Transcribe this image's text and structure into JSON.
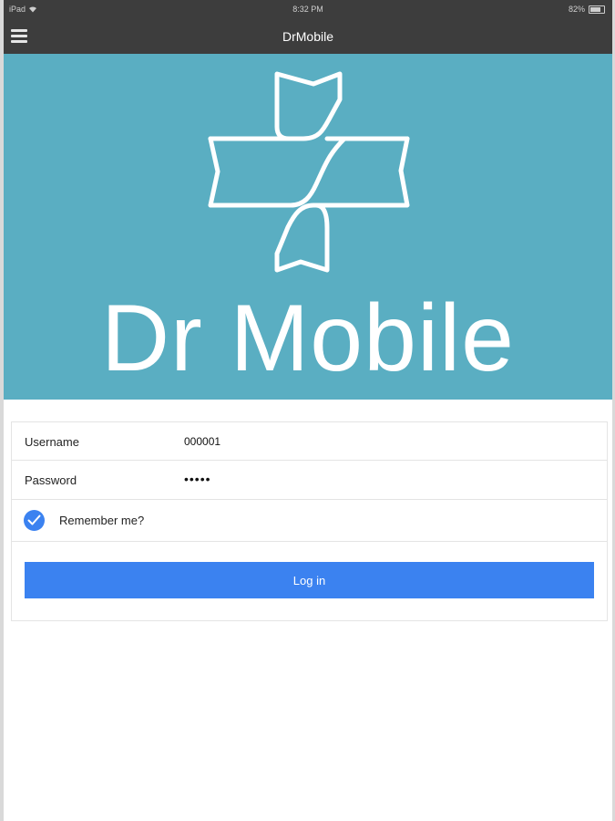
{
  "status_bar": {
    "device": "iPad",
    "wifi_icon": "wifi-icon",
    "time": "8:32 PM",
    "battery_percent": "82%",
    "battery_icon": "battery-icon"
  },
  "nav": {
    "title": "DrMobile",
    "menu_icon": "hamburger-menu-icon"
  },
  "hero": {
    "brand_text": "Dr Mobile",
    "logo_icon": "medical-cross-logo",
    "background_color": "#5aaec2"
  },
  "form": {
    "username_label": "Username",
    "username_value": "000001",
    "password_label": "Password",
    "password_value": "•••••",
    "remember_label": "Remember me?",
    "remember_checked": true,
    "login_label": "Log in",
    "accent_color": "#3b82f0"
  }
}
